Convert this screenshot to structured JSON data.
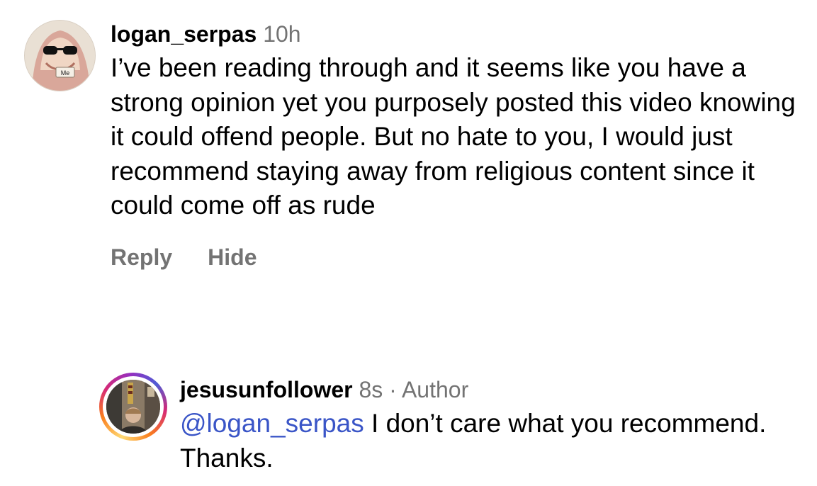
{
  "comments": [
    {
      "username": "logan_serpas",
      "time": "10h",
      "text": "I’ve been reading through and it seems like you have a strong opinion yet you purposely posted this video knowing it could offend people. But no hate to you, I would just recommend staying away from religious content since it could come off as rude",
      "avatar_badge": "Me",
      "actions": {
        "reply": "Reply",
        "hide": "Hide"
      }
    },
    {
      "username": "jesusunfollower",
      "time": "8s",
      "separator": "·",
      "role": "Author",
      "mention": "@logan_serpas",
      "text": " I don’t care what you recommend. Thanks."
    }
  ],
  "colors": {
    "meta_gray": "#737373",
    "mention_blue": "#3a55c7"
  }
}
